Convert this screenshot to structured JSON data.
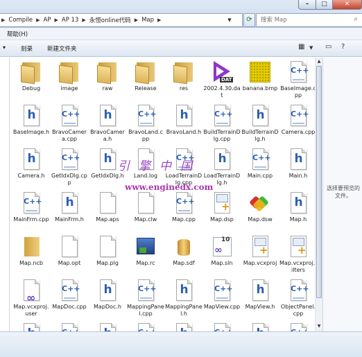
{
  "address_bar": {
    "crumbs": [
      "Compile",
      "AP",
      "AP 13",
      "永恒online代码",
      "Map"
    ],
    "search_placeholder": "搜索 Map"
  },
  "window_controls": {
    "minimize": "–",
    "maximize": "□",
    "close": "✕"
  },
  "menu": {
    "help": "帮助(H)"
  },
  "toolbar": {
    "burn": "刻录",
    "new_folder": "新建文件夹"
  },
  "files": [
    {
      "name": "Debug",
      "type": "folder"
    },
    {
      "name": "image",
      "type": "folder"
    },
    {
      "name": "raw",
      "type": "folder"
    },
    {
      "name": "Release",
      "type": "folder"
    },
    {
      "name": "res",
      "type": "folder"
    },
    {
      "name": "2002.4.30.dat",
      "type": "dat"
    },
    {
      "name": "banana.bmp",
      "type": "bmp"
    },
    {
      "name": "BaseImage.cpp",
      "type": "cpp"
    },
    {
      "name": "BaseImage.h",
      "type": "h"
    },
    {
      "name": "BravoCamera.cpp",
      "type": "cpp"
    },
    {
      "name": "BravoCamera.h",
      "type": "h"
    },
    {
      "name": "BravoLand.cpp",
      "type": "cpp"
    },
    {
      "name": "BravoLand.h",
      "type": "h"
    },
    {
      "name": "BuildTerrainDlg.cpp",
      "type": "cpp"
    },
    {
      "name": "BuildTerrainDlg.h",
      "type": "h"
    },
    {
      "name": "Camera.cpp",
      "type": "cpp"
    },
    {
      "name": "Camera.h",
      "type": "h"
    },
    {
      "name": "GetIdxDlg.cpp",
      "type": "cpp"
    },
    {
      "name": "GetIdxDlg.h",
      "type": "h"
    },
    {
      "name": "Land.log",
      "type": "doc"
    },
    {
      "name": "LoadTerrainDlg.cpp",
      "type": "cpp"
    },
    {
      "name": "LoadTerrainDlg.h",
      "type": "h"
    },
    {
      "name": "Main.cpp",
      "type": "cpp"
    },
    {
      "name": "Main.h",
      "type": "h"
    },
    {
      "name": "MainFrm.cpp",
      "type": "cpp"
    },
    {
      "name": "MainFrm.h",
      "type": "h"
    },
    {
      "name": "Map.aps",
      "type": "doc"
    },
    {
      "name": "Map.clw",
      "type": "doc"
    },
    {
      "name": "Map.cpp",
      "type": "cpp"
    },
    {
      "name": "Map.dsp",
      "type": "vs"
    },
    {
      "name": "Map.dsw",
      "type": "mfc"
    },
    {
      "name": "Map.h",
      "type": "h"
    },
    {
      "name": "Map.ncb",
      "type": "ncb"
    },
    {
      "name": "Map.opt",
      "type": "doc"
    },
    {
      "name": "Map.plg",
      "type": "doc"
    },
    {
      "name": "Map.rc",
      "type": "rc"
    },
    {
      "name": "Map.sdf",
      "type": "sdf"
    },
    {
      "name": "Map.sln",
      "type": "sln"
    },
    {
      "name": "Map.vcxproj",
      "type": "vs"
    },
    {
      "name": "Map.vcxproj.filters",
      "type": "vs"
    },
    {
      "name": "Map.vcxproj.user",
      "type": "user"
    },
    {
      "name": "MapDoc.cpp",
      "type": "cpp"
    },
    {
      "name": "MapDoc.h",
      "type": "h"
    },
    {
      "name": "MappingPanel.cpp",
      "type": "cpp"
    },
    {
      "name": "MappingPanel.h",
      "type": "h"
    },
    {
      "name": "MapView.cpp",
      "type": "cpp"
    },
    {
      "name": "MapView.h",
      "type": "h"
    },
    {
      "name": "ObjectPanel.cpp",
      "type": "cpp"
    },
    {
      "name": "",
      "type": "h"
    },
    {
      "name": "",
      "type": "cpp"
    },
    {
      "name": "",
      "type": "h"
    },
    {
      "name": "",
      "type": "cpp"
    },
    {
      "name": "",
      "type": "h"
    },
    {
      "name": "",
      "type": "cpp"
    },
    {
      "name": "",
      "type": "h"
    },
    {
      "name": "",
      "type": "cpp"
    }
  ],
  "preview": {
    "text": "选择要预览的文件。"
  },
  "watermark": {
    "chinese": "引擎中国",
    "url": "www.enginedx.com"
  }
}
